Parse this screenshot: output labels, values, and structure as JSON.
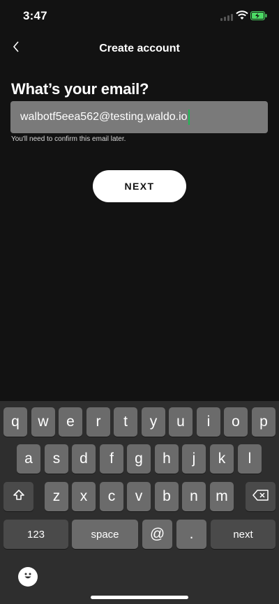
{
  "status": {
    "time": "3:47"
  },
  "nav": {
    "title": "Create account"
  },
  "form": {
    "heading": "What’s your email?",
    "email_value": "walbotf5eea562@testing.waldo.io",
    "helper": "You'll need to confirm this email later.",
    "next_label": "NEXT"
  },
  "keyboard": {
    "row1": [
      "q",
      "w",
      "e",
      "r",
      "t",
      "y",
      "u",
      "i",
      "o",
      "p"
    ],
    "row2": [
      "a",
      "s",
      "d",
      "f",
      "g",
      "h",
      "j",
      "k",
      "l"
    ],
    "row3": [
      "z",
      "x",
      "c",
      "v",
      "b",
      "n",
      "m"
    ],
    "numbers_label": "123",
    "space_label": "space",
    "at_label": "@",
    "dot_label": ".",
    "next_label": "next"
  },
  "colors": {
    "background": "#121212",
    "accent": "#1db954",
    "battery": "#4cd964"
  },
  "icons": [
    "chevron-left-icon",
    "signal-icon",
    "wifi-icon",
    "battery-charging-icon",
    "shift-icon",
    "backspace-icon",
    "emoji-icon"
  ]
}
